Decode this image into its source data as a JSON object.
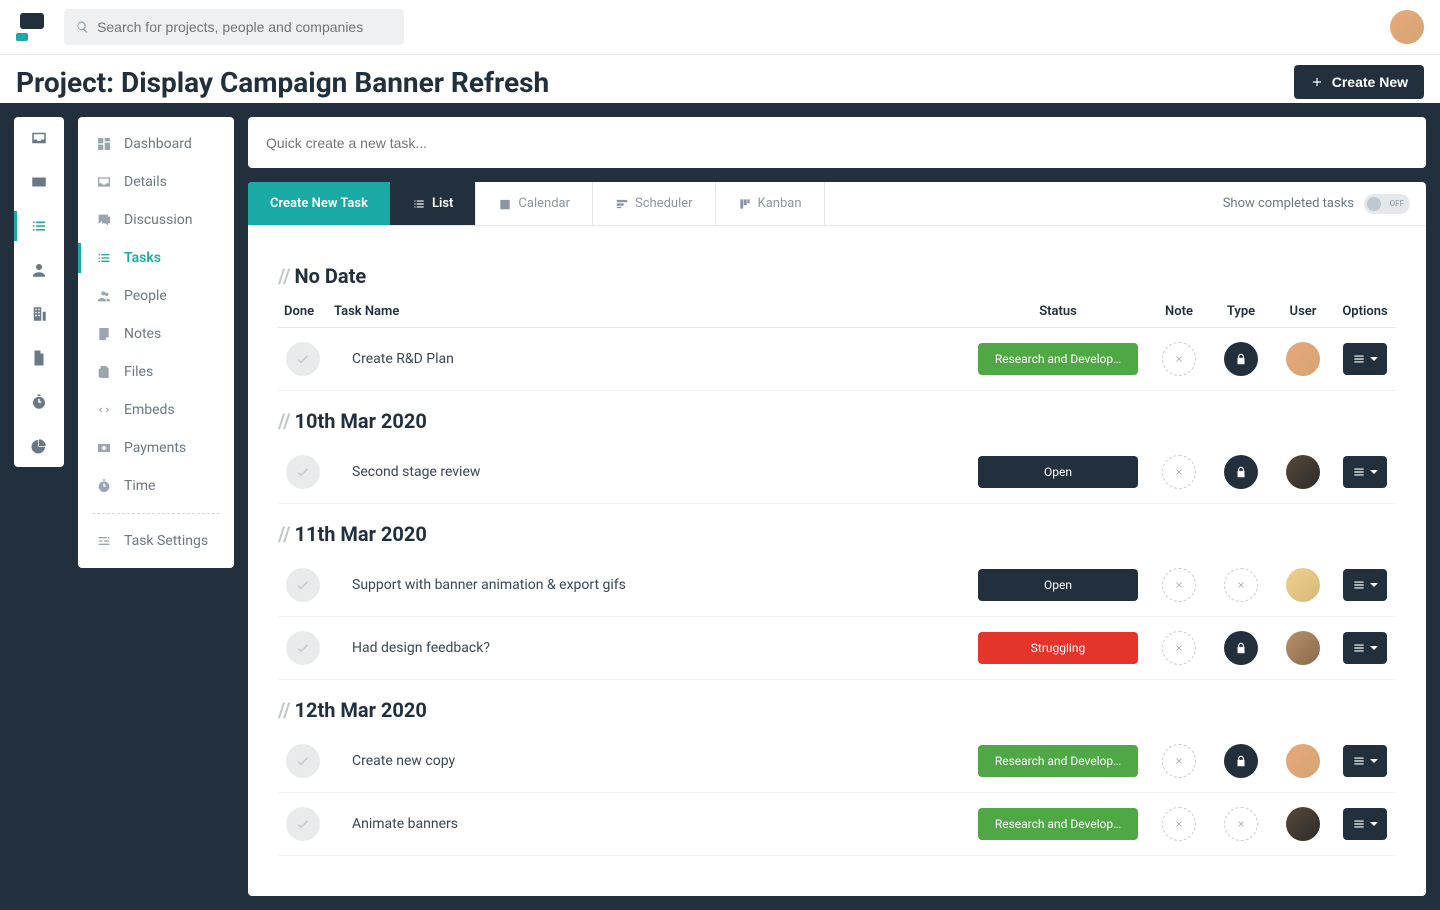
{
  "search": {
    "placeholder": "Search for projects, people and companies"
  },
  "header": {
    "title": "Project: Display Campaign Banner Refresh",
    "create_label": "Create New"
  },
  "sidebar": {
    "items": [
      {
        "label": "Dashboard"
      },
      {
        "label": "Details"
      },
      {
        "label": "Discussion"
      },
      {
        "label": "Tasks"
      },
      {
        "label": "People"
      },
      {
        "label": "Notes"
      },
      {
        "label": "Files"
      },
      {
        "label": "Embeds"
      },
      {
        "label": "Payments"
      },
      {
        "label": "Time"
      }
    ],
    "settings_label": "Task Settings"
  },
  "quick_create": {
    "placeholder": "Quick create a new task..."
  },
  "tabs": {
    "create": "Create New Task",
    "list": "List",
    "calendar": "Calendar",
    "scheduler": "Scheduler",
    "kanban": "Kanban",
    "show_completed_label": "Show completed tasks",
    "toggle_state": "OFF"
  },
  "columns": {
    "done": "Done",
    "name": "Task Name",
    "status": "Status",
    "note": "Note",
    "type": "Type",
    "user": "User",
    "options": "Options"
  },
  "sections": [
    {
      "title": "No Date",
      "tasks": [
        {
          "name": "Create R&D Plan",
          "status": "Research and Develop…",
          "status_class": "status-green",
          "type_locked": true,
          "avatar": "av-1"
        }
      ]
    },
    {
      "title": "10th Mar 2020",
      "tasks": [
        {
          "name": "Second stage review",
          "status": "Open",
          "status_class": "status-dark",
          "type_locked": true,
          "avatar": "av-2"
        }
      ]
    },
    {
      "title": "11th Mar 2020",
      "tasks": [
        {
          "name": "Support with banner animation & export gifs",
          "status": "Open",
          "status_class": "status-dark",
          "type_locked": false,
          "avatar": "av-3"
        },
        {
          "name": "Had design feedback?",
          "status": "Struggling",
          "status_class": "status-red",
          "type_locked": true,
          "avatar": "av-4"
        }
      ]
    },
    {
      "title": "12th Mar 2020",
      "tasks": [
        {
          "name": "Create new copy",
          "status": "Research and Develop…",
          "status_class": "status-green",
          "type_locked": true,
          "avatar": "av-1"
        },
        {
          "name": "Animate banners",
          "status": "Research and Develop…",
          "status_class": "status-green",
          "type_locked": false,
          "avatar": "av-2"
        }
      ]
    }
  ]
}
